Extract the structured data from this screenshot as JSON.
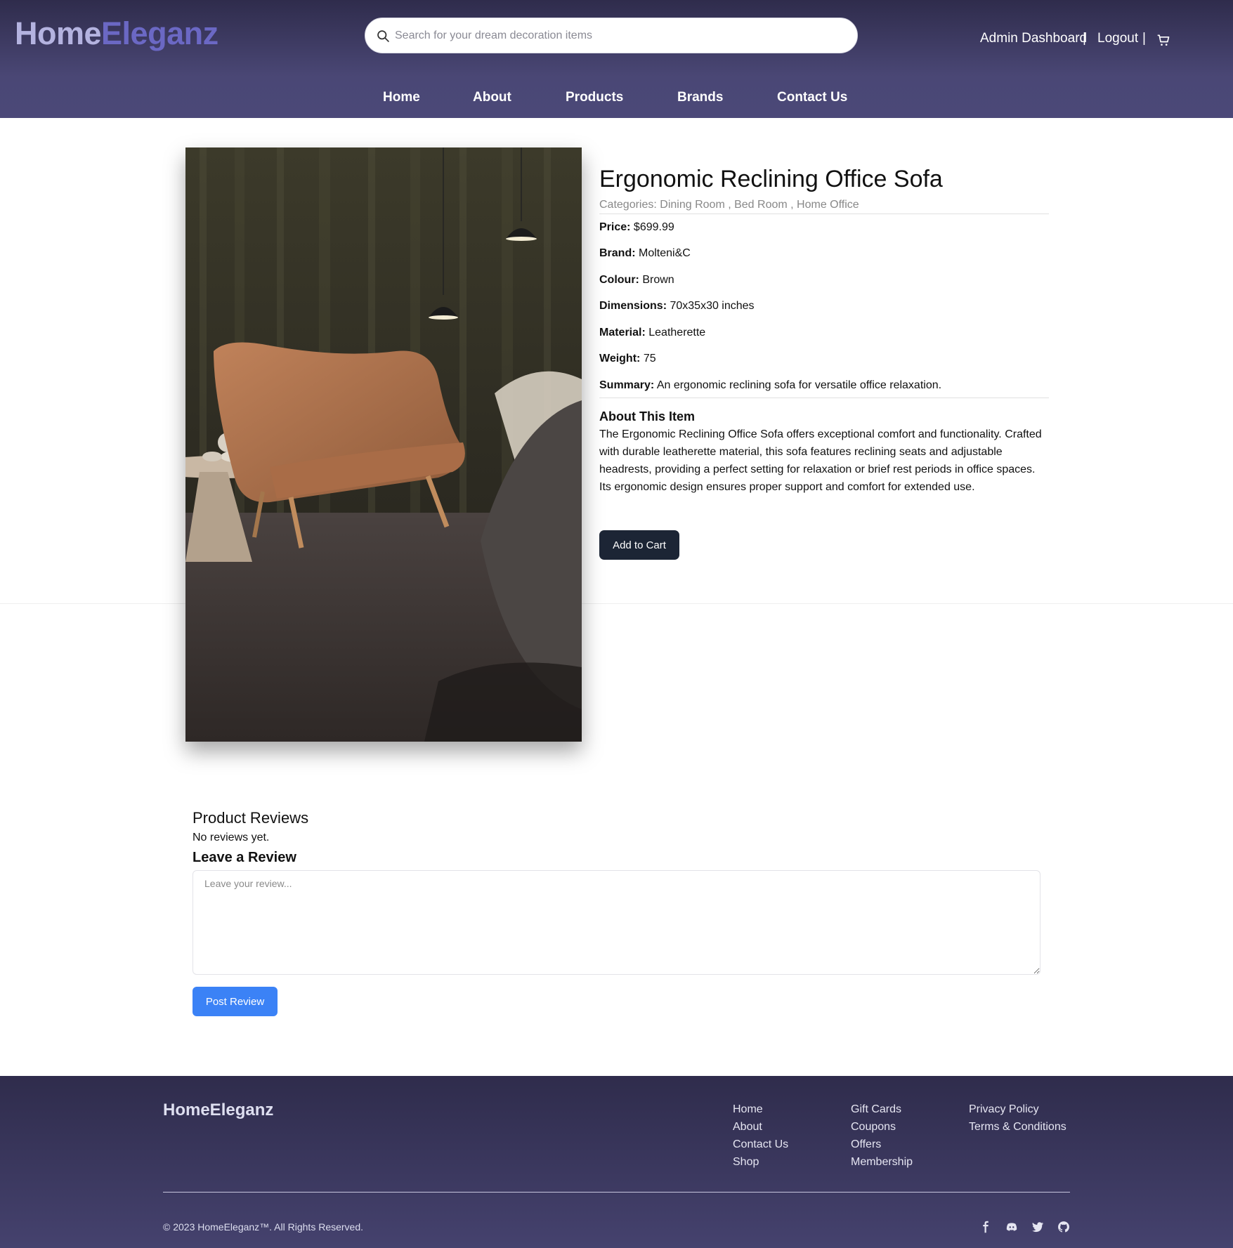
{
  "brand": {
    "part1": "Home",
    "part2": "Eleganz",
    "color1": "#b4b3e0",
    "color2": "#6b68c4"
  },
  "search": {
    "placeholder": "Search for your dream decoration items",
    "icon": "search-icon"
  },
  "topbar": {
    "admin": "Admin Dashboard",
    "sep1": "|",
    "logout": "Logout",
    "sep2": "|",
    "cart_icon": "cart-icon"
  },
  "nav": {
    "items": [
      "Home",
      "About",
      "Products",
      "Brands",
      "Contact Us"
    ]
  },
  "product": {
    "title": "Ergonomic Reclining Office Sofa",
    "categories_label": "Categories:",
    "categories": "Dining Room , Bed Room , Home Office",
    "specs": [
      {
        "label": "Price:",
        "value": "$699.99"
      },
      {
        "label": "Brand:",
        "value": "Molteni&C"
      },
      {
        "label": "Colour:",
        "value": "Brown"
      },
      {
        "label": "Dimensions:",
        "value": "70x35x30 inches"
      },
      {
        "label": "Material:",
        "value": "Leatherette"
      },
      {
        "label": "Weight:",
        "value": "75"
      },
      {
        "label": "Summary:",
        "value": "An ergonomic reclining sofa for versatile office relaxation."
      }
    ],
    "about_heading": "About This Item",
    "about_text": "The Ergonomic Reclining Office Sofa offers exceptional comfort and functionality. Crafted with durable leatherette material, this sofa features reclining seats and adjustable headrests, providing a perfect setting for relaxation or brief rest periods in office spaces. Its ergonomic design ensures proper support and comfort for extended use.",
    "add_to_cart": "Add to Cart"
  },
  "reviews": {
    "heading": "Product Reviews",
    "empty": "No reviews yet.",
    "leave_heading": "Leave a Review",
    "placeholder": "Leave your review...",
    "post_button": "Post Review",
    "post_color": "#3b82f6"
  },
  "footer": {
    "logo": "HomeEleganz",
    "col1": [
      "Home",
      "About",
      "Contact Us",
      "Shop"
    ],
    "col2": [
      "Gift Cards",
      "Coupons",
      "Offers",
      "Membership"
    ],
    "col3": [
      "Privacy Policy",
      "Terms & Conditions"
    ],
    "copyright": "© 2023 HomeEleganz™. All Rights Reserved.",
    "social_icons": [
      "facebook-icon",
      "discord-icon",
      "twitter-icon",
      "github-icon"
    ]
  }
}
